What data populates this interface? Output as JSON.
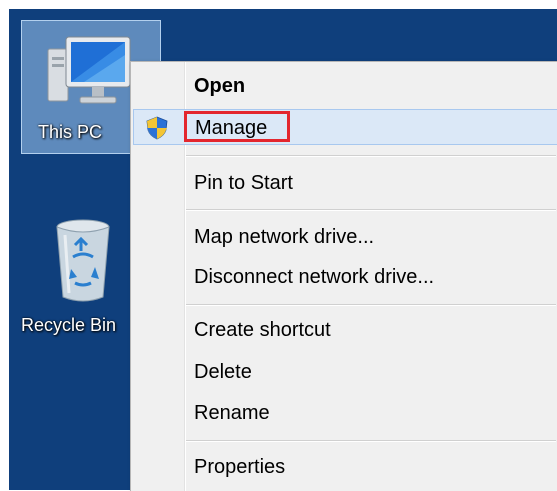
{
  "desktop": {
    "background": "#0f3f7c",
    "icons": [
      {
        "label": "This PC",
        "icon": "computer-icon",
        "selected": true
      },
      {
        "label": "Recycle Bin",
        "icon": "recycle-bin-icon",
        "selected": false
      }
    ]
  },
  "context_menu": {
    "items": {
      "open": "Open",
      "manage": "Manage",
      "pin_to_start": "Pin to Start",
      "map_network_drive": "Map network drive...",
      "disconnect_network_drive": "Disconnect network drive...",
      "create_shortcut": "Create shortcut",
      "delete": "Delete",
      "rename": "Rename",
      "properties": "Properties"
    },
    "hovered_item": "Manage",
    "manage_icon": "uac-shield-icon",
    "highlight_color": "#e3262e"
  }
}
